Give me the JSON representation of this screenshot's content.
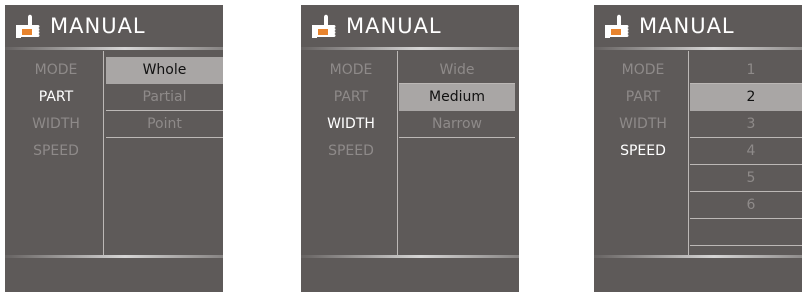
{
  "panels": [
    {
      "title": "MANUAL",
      "menu": [
        "MODE",
        "PART",
        "WIDTH",
        "SPEED"
      ],
      "active_menu": "PART",
      "options": [
        "Whole",
        "Partial",
        "Point"
      ],
      "selected_option": "Whole"
    },
    {
      "title": "MANUAL",
      "menu": [
        "MODE",
        "PART",
        "WIDTH",
        "SPEED"
      ],
      "active_menu": "WIDTH",
      "options": [
        "Wide",
        "Medium",
        "Narrow"
      ],
      "selected_option": "Medium"
    },
    {
      "title": "MANUAL",
      "menu": [
        "MODE",
        "PART",
        "WIDTH",
        "SPEED"
      ],
      "active_menu": "SPEED",
      "options": [
        "1",
        "2",
        "3",
        "4",
        "5",
        "6"
      ],
      "selected_option": "2"
    }
  ],
  "colors": {
    "panel_bg": "#5e5a59",
    "selected_bg": "#a9a6a5",
    "inactive_text": "#8e8a89",
    "active_text": "#ffffff"
  },
  "icons": {
    "header": "thumbs-up-hand-icon"
  }
}
